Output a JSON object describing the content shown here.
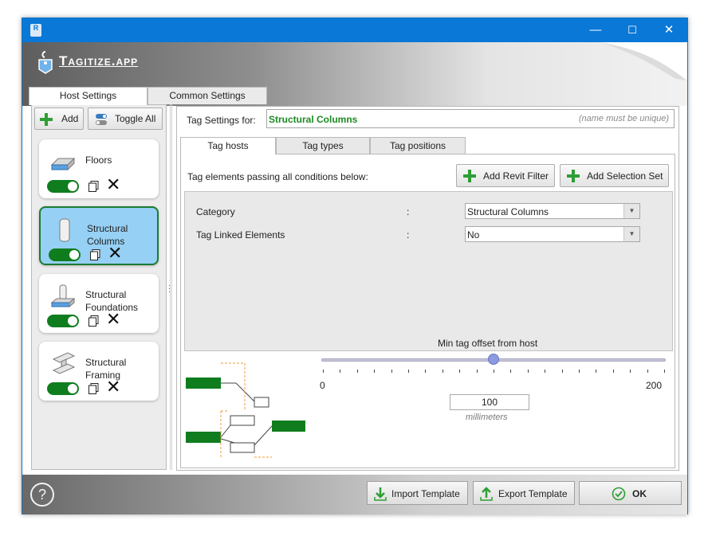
{
  "titlebar": {
    "app_icon_text": "R",
    "minimize": "—",
    "maximize": "☐",
    "close": "✕"
  },
  "header": {
    "logo_text": "Tagitize.app"
  },
  "top_tabs": [
    {
      "label": "Host Settings",
      "active": true
    },
    {
      "label": "Common Settings",
      "active": false
    }
  ],
  "sidebar": {
    "add_label": "Add",
    "toggle_all_label": "Toggle All",
    "hosts": [
      {
        "name_line1": "Floors",
        "name_line2": "",
        "enabled": true,
        "selected": false,
        "icon": "floor-icon"
      },
      {
        "name_line1": "Structural",
        "name_line2": "Columns",
        "enabled": true,
        "selected": true,
        "icon": "column-icon"
      },
      {
        "name_line1": "Structural",
        "name_line2": "Foundations",
        "enabled": true,
        "selected": false,
        "icon": "foundation-icon"
      },
      {
        "name_line1": "Structural",
        "name_line2": "Framing",
        "enabled": true,
        "selected": false,
        "icon": "framing-icon"
      }
    ],
    "remove_glyph": "✕"
  },
  "main": {
    "tag_settings_for_label": "Tag Settings for:",
    "tag_settings_value": "Structural Columns",
    "tag_settings_hint": "(name must be unique)",
    "subtabs": [
      {
        "label": "Tag hosts",
        "active": true
      },
      {
        "label": "Tag types",
        "active": false
      },
      {
        "label": "Tag positions",
        "active": false
      }
    ],
    "conditions_label": "Tag elements passing all conditions below:",
    "add_revit_filter_label": "Add Revit Filter",
    "add_selection_set_label": "Add Selection Set",
    "conditions": [
      {
        "label": "Category",
        "separator": ":",
        "value": "Structural Columns"
      },
      {
        "label": "Tag Linked Elements",
        "separator": ":",
        "value": "No"
      }
    ],
    "offset": {
      "title": "Min tag offset from host",
      "min": "0",
      "max": "200",
      "value": "100",
      "unit": "millimeters",
      "fraction": 0.5
    }
  },
  "footer": {
    "help_glyph": "?",
    "import_label": "Import Template",
    "export_label": "Export Template",
    "ok_label": "OK"
  },
  "colors": {
    "accent_green": "#0f7d1e",
    "title_blue": "#0a78d7",
    "selected_card": "#96d0f5"
  }
}
